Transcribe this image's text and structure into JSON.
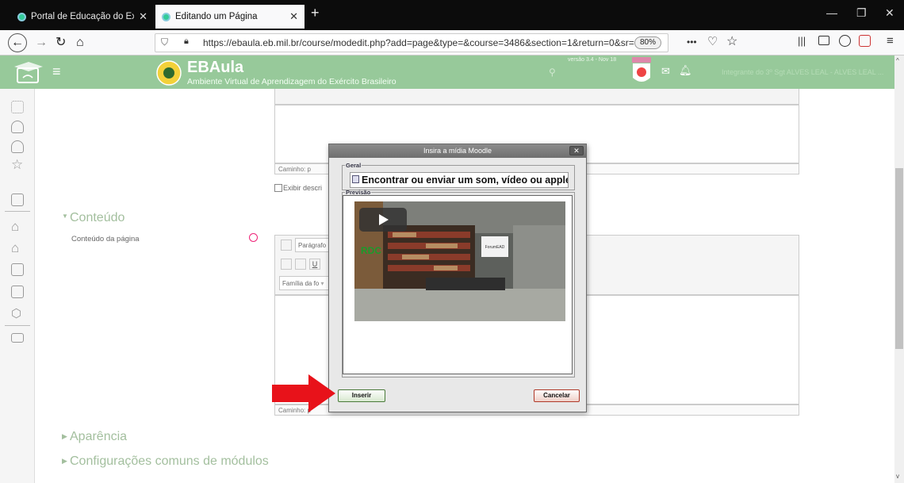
{
  "browser": {
    "tabs": [
      {
        "label": "Portal de Educação do Exército"
      },
      {
        "label": "Editando um Página"
      }
    ],
    "url": "https://ebaula.eb.mil.br/course/modedit.php?add=page&type=&course=3486&section=1&return=0&sr=",
    "zoom": "80%",
    "menu_dots": "•••"
  },
  "site": {
    "title": "EBAula",
    "subtitle": "Ambiente Virtual de Aprendizagem do Exército Brasileiro",
    "version": "versão 3.4 - Nov 18",
    "user_text": "Integrante do 3º Sgt ALVES LEAL - ALVES LEAL ..."
  },
  "form": {
    "path_label_1": "Caminho: p",
    "show_description": "Exibir descri",
    "section_content": "Conteúdo",
    "page_content_label": "Conteúdo da página",
    "paragraph_select": "Parágrafo",
    "font_family_select": "Família da fo",
    "path_label_2": "Caminho: p",
    "section_appearance": "Aparência",
    "section_common": "Configurações comuns de módulos"
  },
  "dialog": {
    "title": "Insira a mídia Moodle",
    "general_legend": "Geral",
    "find_button": "Encontrar ou enviar um som, vídeo ou applet...",
    "preview_legend": "Previsão",
    "video_sign": "ForumEAD",
    "insert_button": "Inserir",
    "cancel_button": "Cancelar"
  },
  "colors": {
    "header_green": "#97c99a",
    "arrow_red": "#e8121a"
  }
}
